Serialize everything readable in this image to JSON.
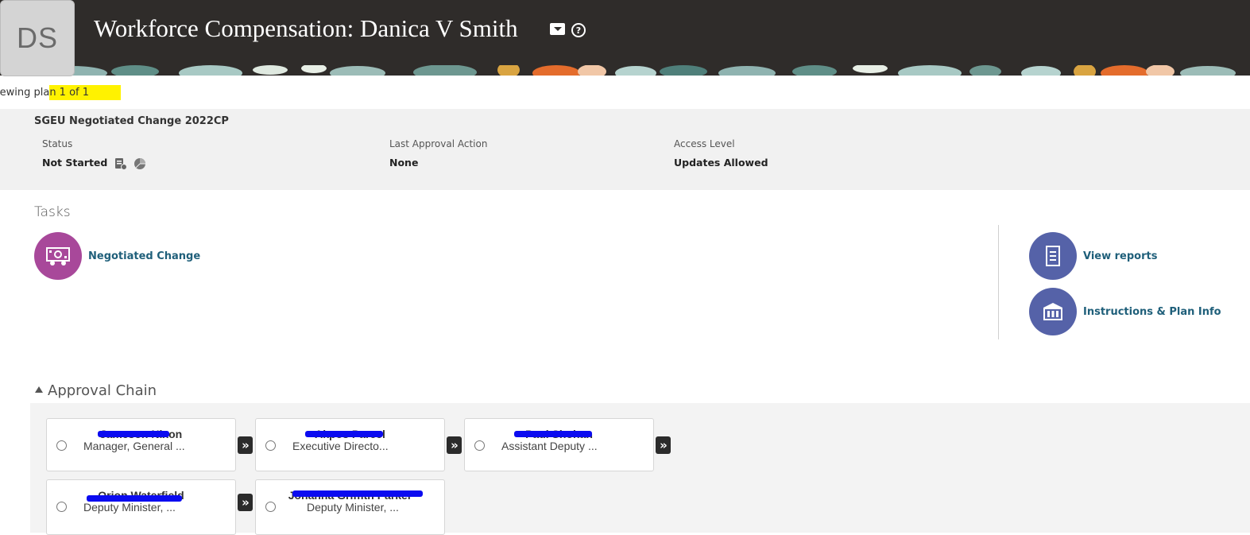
{
  "header": {
    "avatar_initials": "DS",
    "title": "Workforce Compensation: Danica V Smith",
    "dropdown_icon": "caret-down-icon",
    "help_icon": "help-icon"
  },
  "viewing": {
    "prefix": "iewing pla",
    "highlighted": "n 1 of 1"
  },
  "plan": {
    "name": "SGEU Negotiated Change 2022CP",
    "status_label": "Status",
    "status_value": "Not Started",
    "last_action_label": "Last Approval Action",
    "last_action_value": "None",
    "access_label": "Access Level",
    "access_value": "Updates Allowed"
  },
  "tasks": {
    "title": "Tasks",
    "items": [
      {
        "label": "Negotiated Change",
        "icon": "compensation-icon",
        "color": "#a8489a"
      }
    ],
    "side_items": [
      {
        "label": "View reports",
        "icon": "report-icon",
        "color": "#5562a8"
      },
      {
        "label": "Instructions & Plan Info",
        "icon": "building-icon",
        "color": "#5562a8"
      }
    ]
  },
  "approval_chain": {
    "title": "Approval Chain",
    "cards": [
      {
        "name": "Jameson Nixon",
        "role": "Manager, General ..."
      },
      {
        "name": "Akpos Parcel",
        "role": "Executive Directo..."
      },
      {
        "name": "Paul Shohan",
        "role": "Assistant Deputy ..."
      },
      {
        "name": "Orion Waterfield",
        "role": "Deputy Minister, ..."
      },
      {
        "name": "Johanna Griffith Parker",
        "role": "Deputy Minister, ..."
      }
    ],
    "arrow_glyph": "»"
  },
  "colors": {
    "header_bg": "#2f2c2a",
    "link": "#1f5f7a",
    "highlight": "#fff200",
    "redaction": "#0b0bf0"
  }
}
